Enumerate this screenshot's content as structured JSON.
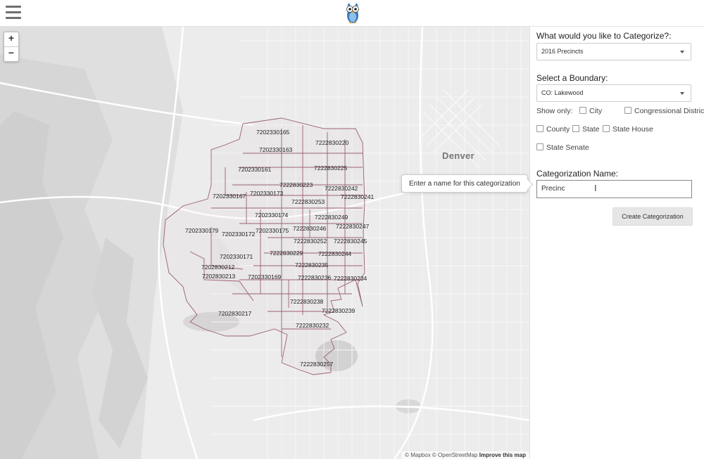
{
  "header": {
    "menu_icon": "hamburger-icon",
    "logo_icon": "owl-logo-icon"
  },
  "map": {
    "zoom_in": "+",
    "zoom_out": "−",
    "city_label": "Denver",
    "attribution": {
      "text": "© Mapbox © OpenStreetMap",
      "link": "Improve this map"
    },
    "tooltip": "Enter a name for this categorization",
    "boundary_color": "#9b6070",
    "precincts": [
      "7202330165",
      "7222830220",
      "7202330163",
      "7222830225",
      "7202330161",
      "7222830223",
      "7222830242",
      "7202330173",
      "7202330167",
      "7222830241",
      "7222830253",
      "7202330174",
      "7222830249",
      "7202330179",
      "7222830246",
      "7222830247",
      "7202330172",
      "7202330175",
      "7222830252",
      "7222830245",
      "7222830229",
      "7222830244",
      "7202330171",
      "7222830235",
      "7202830212",
      "7202830213",
      "7202330169",
      "7222830236",
      "7222830234",
      "7222830238",
      "7222830239",
      "7202830217",
      "7222830232",
      "7222830257"
    ]
  },
  "panel": {
    "categorize_label": "What would you like to Categorize?:",
    "categorize_value": "2016 Precincts",
    "boundary_label": "Select a Boundary:",
    "boundary_value": "CO: Lakewood",
    "show_only_label": "Show only:",
    "filters": [
      "City",
      "Congressional District",
      "County",
      "State",
      "State House",
      "State Senate"
    ],
    "name_label": "Categorization Name:",
    "name_value": "Precinc",
    "create_button": "Create Categorization"
  }
}
